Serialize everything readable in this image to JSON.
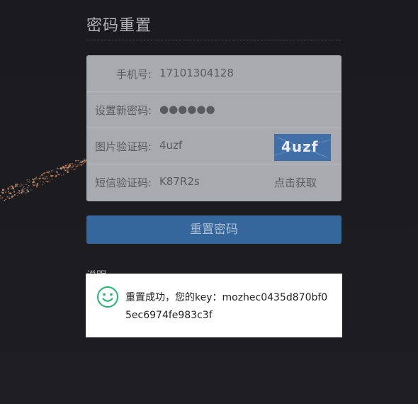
{
  "page": {
    "title": "密码重置"
  },
  "form": {
    "phone": {
      "label": "手机号:",
      "value": "17101304128"
    },
    "new_password": {
      "label": "设置新密码:",
      "value": "●●●●●●"
    },
    "image_captcha": {
      "label": "图片验证码:",
      "value": "4uzf",
      "captcha_image_text": "4uzf"
    },
    "sms_code": {
      "label": "短信验证码:",
      "value": "K87R2s",
      "action_label": "点击获取"
    }
  },
  "reset_button": {
    "label": "重置密码"
  },
  "notes": {
    "heading": "说明"
  },
  "toast": {
    "icon": "smile-icon",
    "message": "重置成功，您的key：mozhec0435d870bf05ec6974fe983c3f"
  },
  "colors": {
    "background": "#1c1c21",
    "form_bg": "#a9aab0",
    "button_bg": "#36679c",
    "toast_icon": "#1fb86f",
    "captcha_bg": "#3f6fa6"
  }
}
